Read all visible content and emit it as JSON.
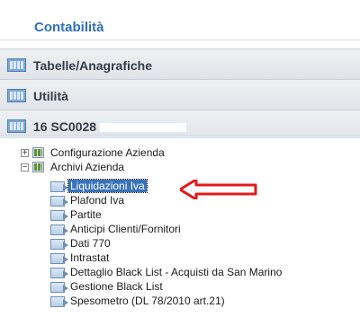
{
  "header": {
    "title": "Contabilità"
  },
  "sections": [
    {
      "label": "Tabelle/Anagrafiche"
    },
    {
      "label": "Utilità"
    },
    {
      "label": "16 SC0028"
    }
  ],
  "tree": {
    "nodes": [
      {
        "label": "Configurazione Azienda",
        "expander": "+"
      },
      {
        "label": "Archivi Azienda",
        "expander": "−"
      }
    ],
    "items": [
      "Liquidazioni Iva",
      "Plafond Iva",
      "Partite",
      "Anticipi Clienti/Fornitori",
      "Dati 770",
      "Intrastat",
      "Dettaglio Black List - Acquisti da San Marino",
      "Gestione Black List",
      "Spesometro (DL 78/2010 art.21)"
    ],
    "selected_index": 0
  },
  "colors": {
    "title": "#2f6fb7",
    "selection": "#3a74b8",
    "arrow": "#e01b1b"
  },
  "icons": {
    "section": "grid-icon",
    "node": "folder-grid-icon",
    "item": "item-icon",
    "arrow": "red-arrow-icon"
  }
}
